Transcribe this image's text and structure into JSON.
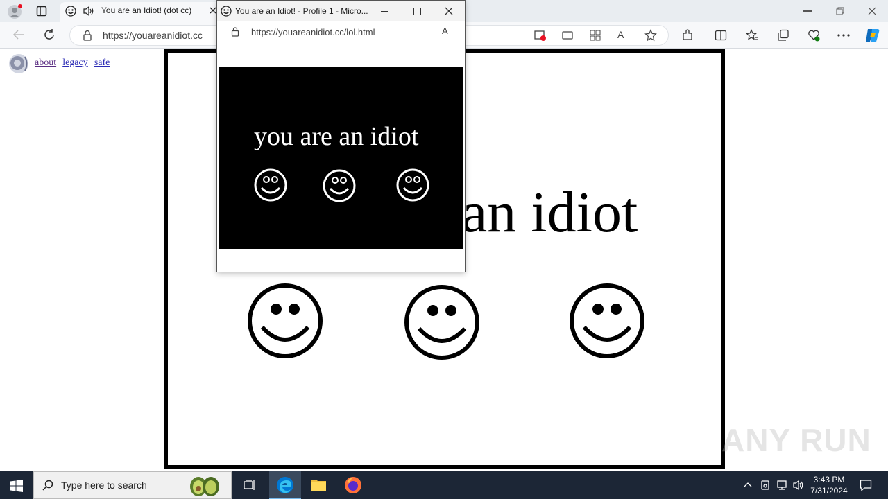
{
  "browser": {
    "tab_title": "You are an Idiot! (dot cc)",
    "url": "https://youareanidiot.cc"
  },
  "page": {
    "links": [
      "about",
      "legacy",
      "safe"
    ],
    "heading": "an idiot"
  },
  "popup": {
    "title": "You are an Idiot! - Profile 1 - Micro...",
    "url": "https://youareanidiot.cc/lol.html",
    "text": "you are an idiot"
  },
  "taskbar": {
    "search_placeholder": "Type here to search",
    "time": "3:43 PM",
    "date": "7/31/2024"
  },
  "watermark": "ANY RUN",
  "colors": {
    "taskbar": "#1c2636",
    "link": "#2b2bb5",
    "edge_blue": "#0078d4"
  }
}
